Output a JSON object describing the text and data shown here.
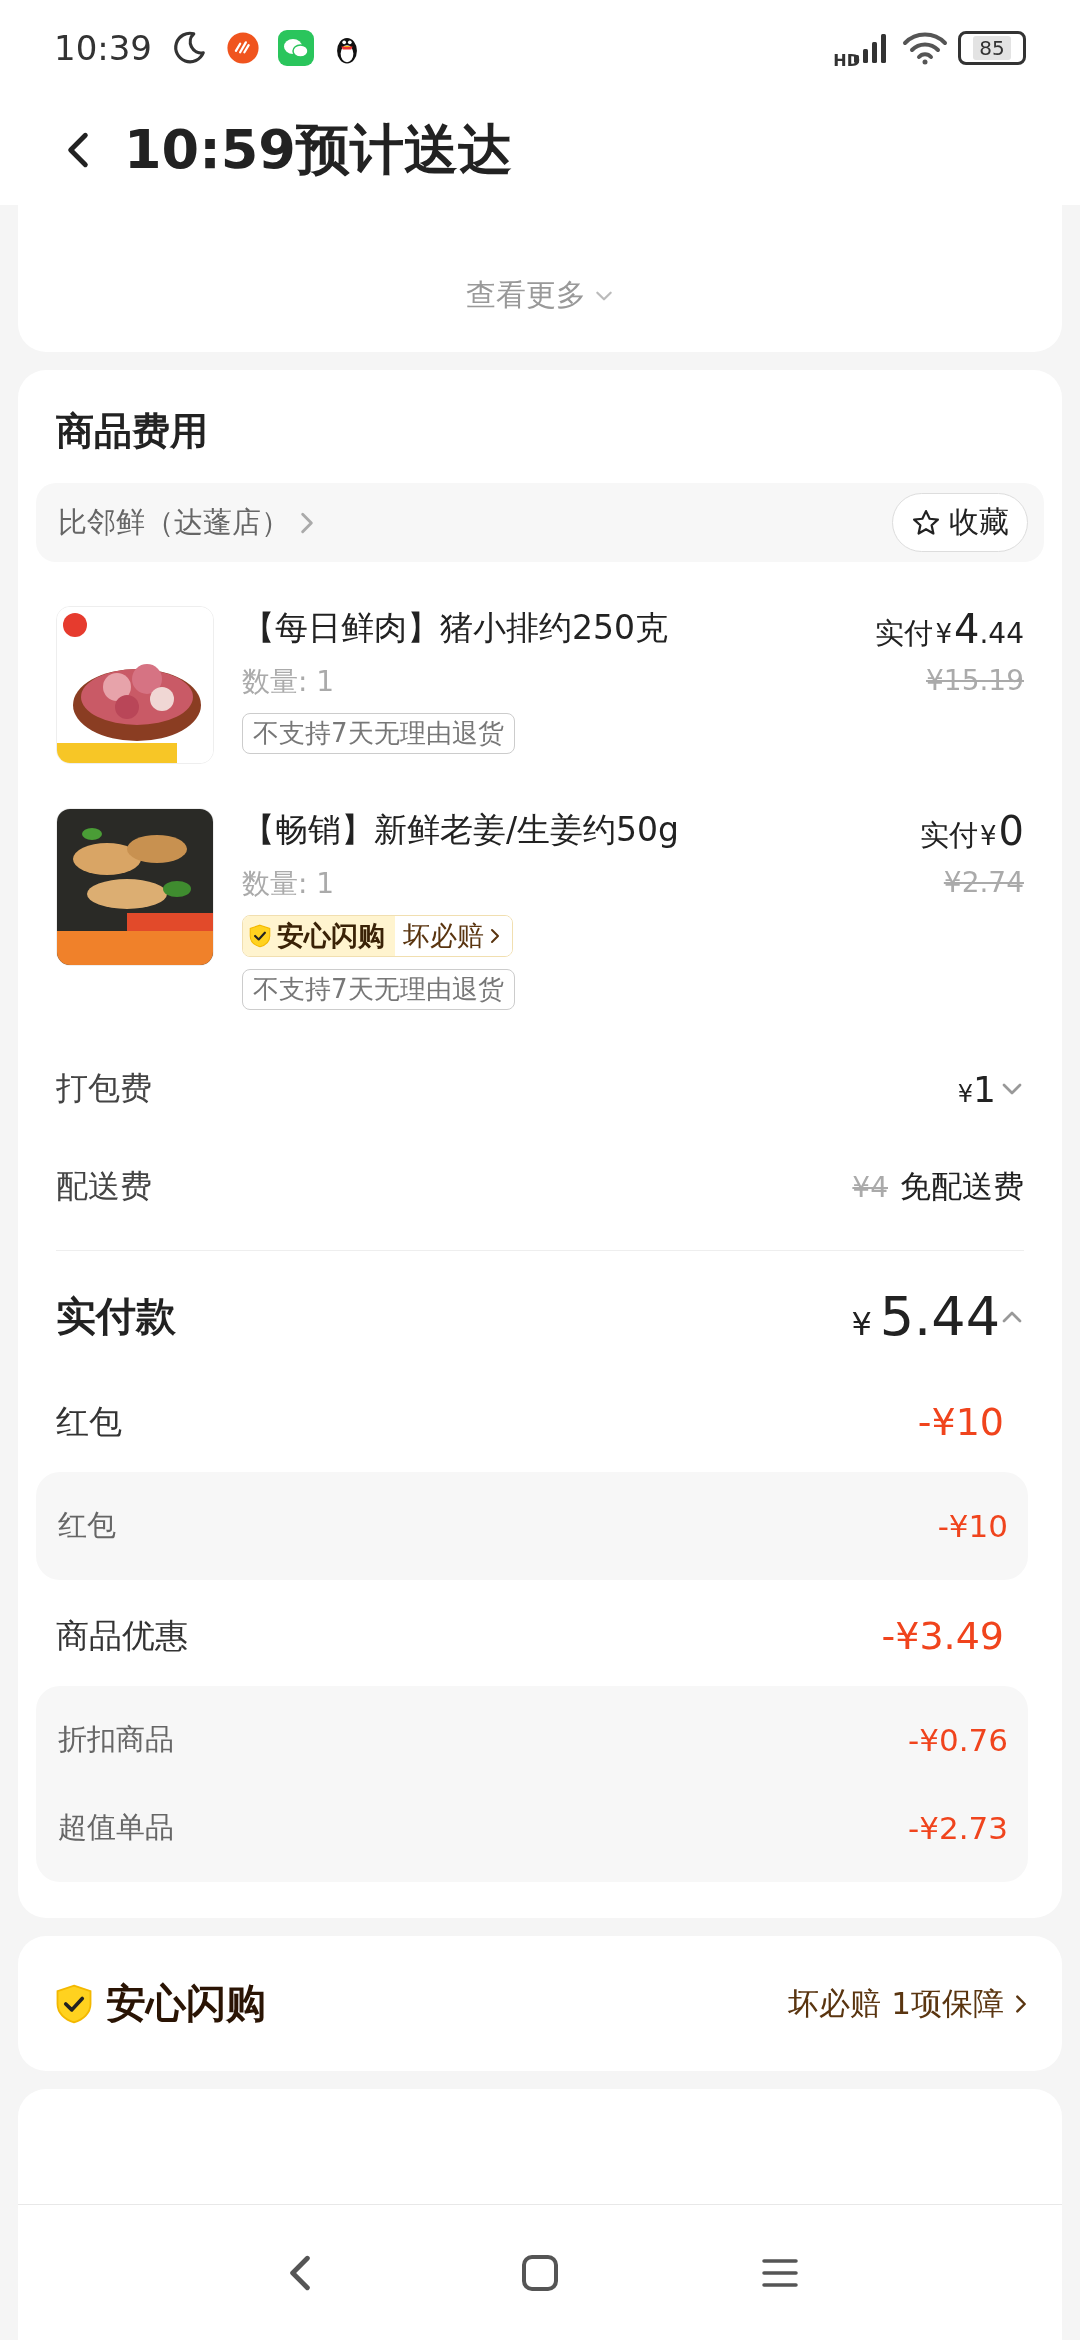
{
  "status_bar": {
    "time": "10:39",
    "network": "HD",
    "battery": "85"
  },
  "header": {
    "title": "10:59预计送达"
  },
  "previous_card": {
    "more_link": "查看更多"
  },
  "fees": {
    "title": "商品费用",
    "shop": {
      "name": "比邻鲜（达蓬店）",
      "favorite_button": "收藏"
    },
    "items": [
      {
        "name": "【每日鲜肉】猪小排约250克",
        "quantity": "数量: 1",
        "paid_label": "实付",
        "currency": "¥",
        "price_integer": "4",
        "price_decimal": ".44",
        "original_price": "¥15.19",
        "tags": [
          "不支持7天无理由退货"
        ]
      },
      {
        "name": "【畅销】新鲜老姜/生姜约50g",
        "quantity": "数量: 1",
        "paid_label": "实付",
        "currency": "¥",
        "price_integer": "0",
        "original_price": "¥2.74",
        "guarantee": {
          "title": "安心闪购",
          "link": "坏必赔"
        },
        "tags": [
          "不支持7天无理由退货"
        ]
      }
    ],
    "charges": [
      {
        "label": "打包费",
        "kind": "dropdown",
        "currency": "¥",
        "amount": "1",
        "expanded": false
      },
      {
        "label": "配送费",
        "kind": "waived",
        "original": "¥4",
        "value": "免配送费"
      }
    ],
    "total": {
      "label": "实付款",
      "currency": "¥",
      "amount": "5.44",
      "expanded": true
    },
    "discounts": [
      {
        "label": "红包",
        "amount": "-¥10",
        "details": [
          {
            "label": "红包",
            "amount": "-¥10"
          }
        ]
      },
      {
        "label": "商品优惠",
        "amount": "-¥3.49",
        "details": [
          {
            "label": "折扣商品",
            "amount": "-¥0.76"
          },
          {
            "label": "超值单品",
            "amount": "-¥2.73"
          }
        ]
      }
    ]
  },
  "guarantee_card": {
    "title": "安心闪购",
    "link": "坏必赔 1项保障"
  }
}
